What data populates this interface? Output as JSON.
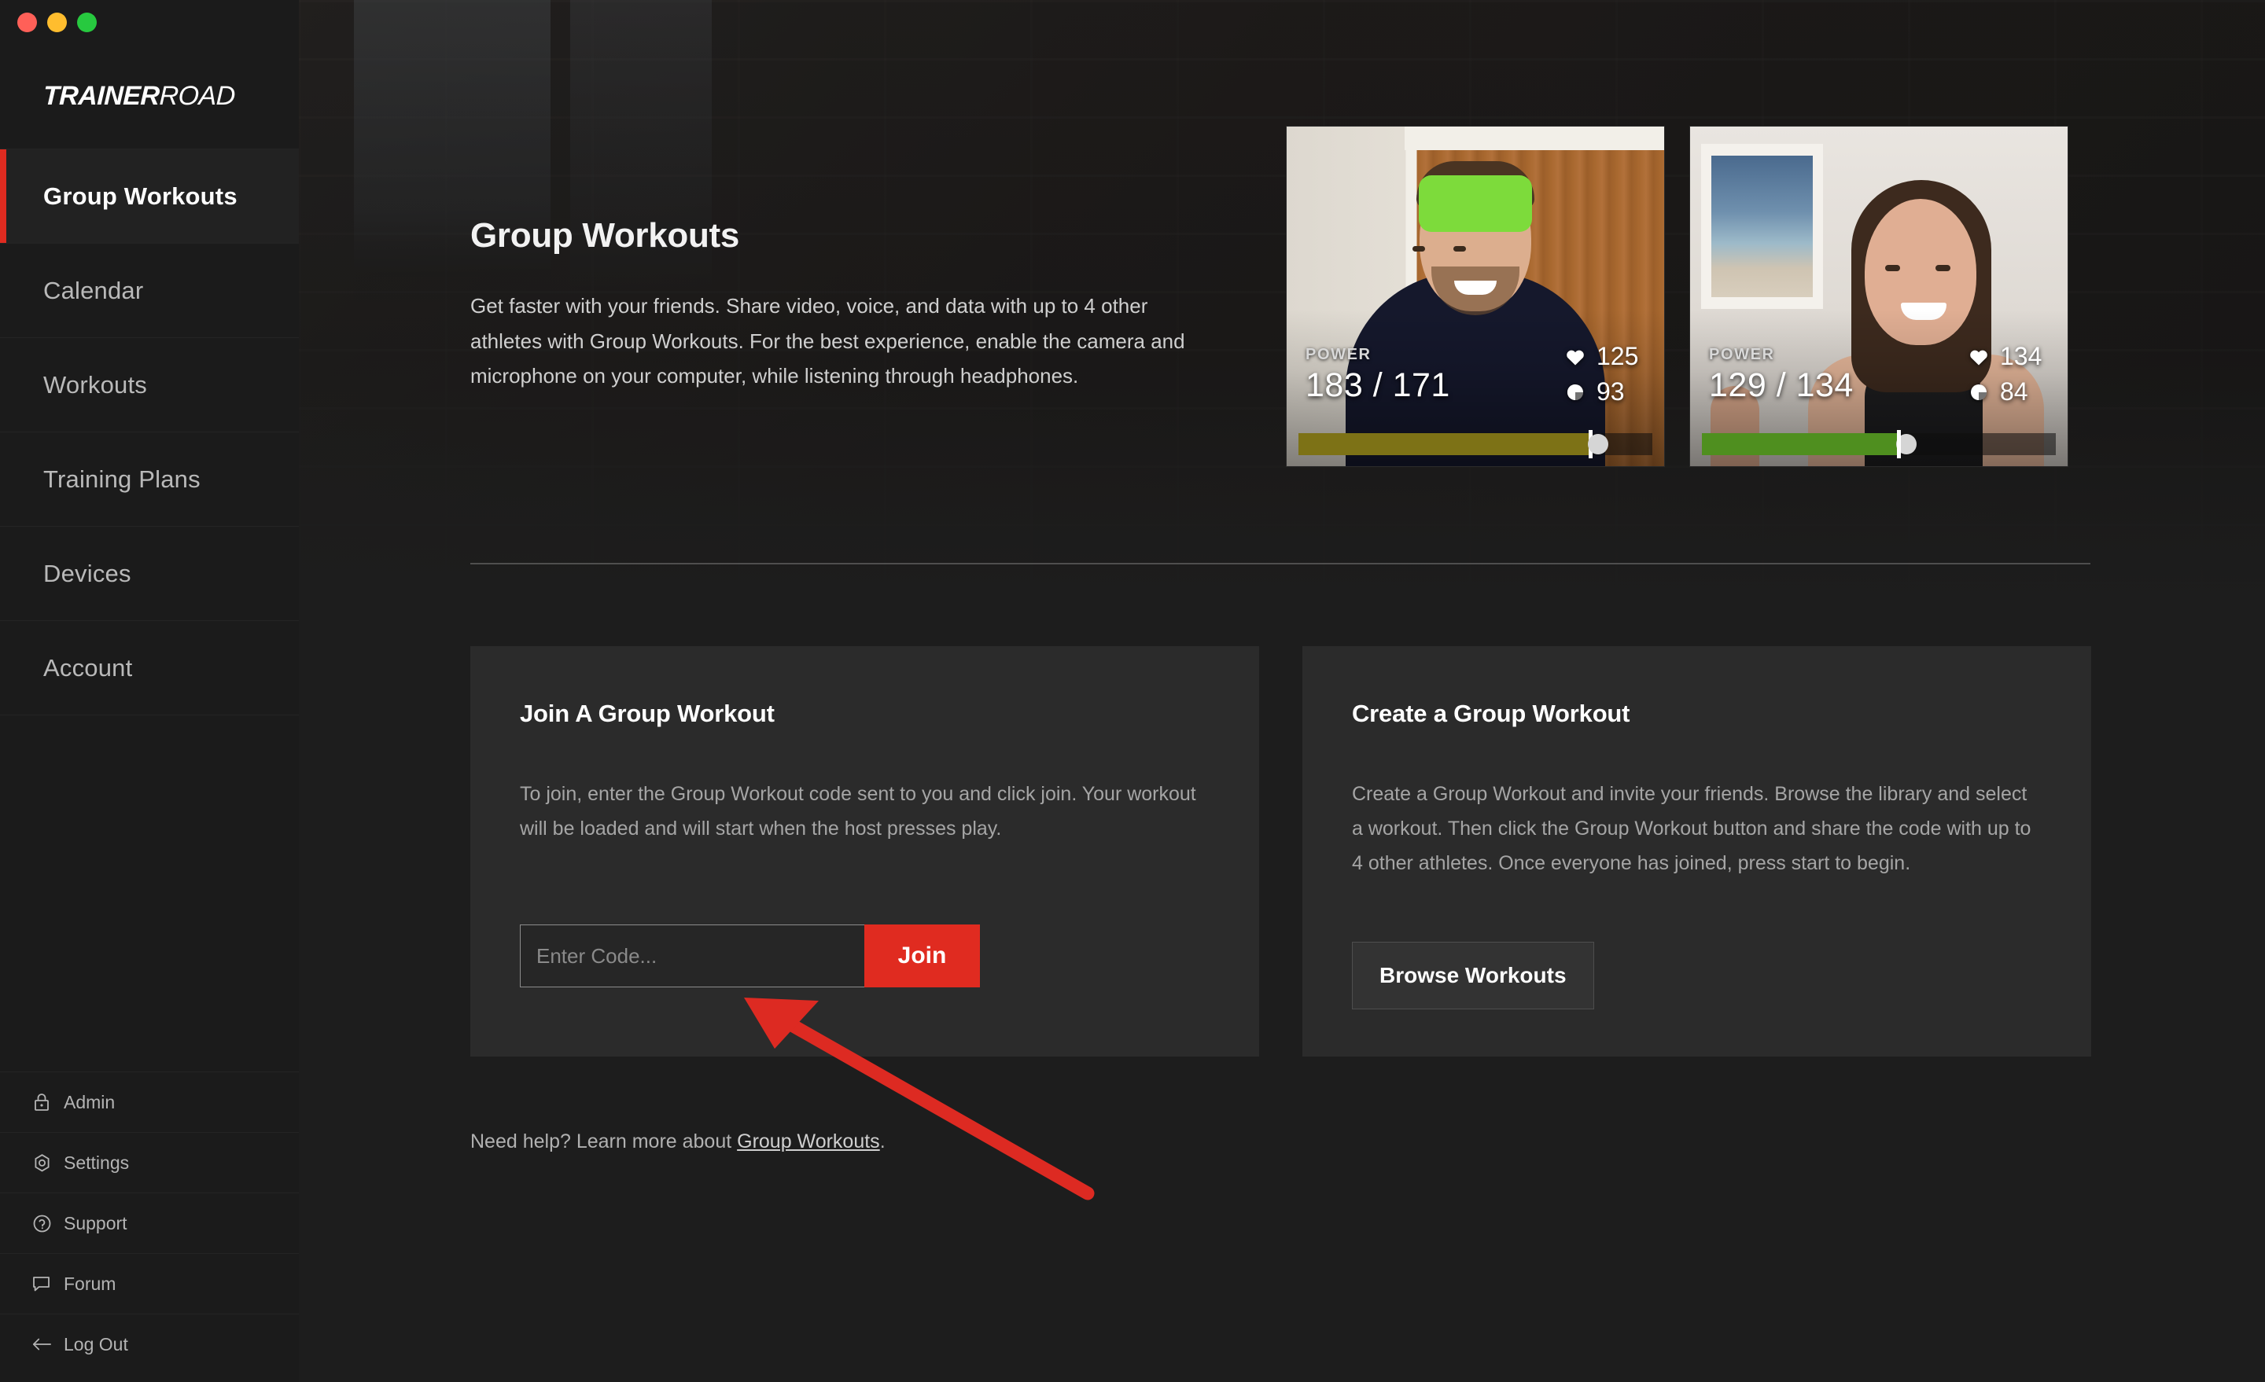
{
  "window": {
    "traffic_lights": [
      "close",
      "minimize",
      "zoom"
    ],
    "accent_red": "#e02b20"
  },
  "sidebar": {
    "logo_bold": "TRAINER",
    "logo_normal": "ROAD",
    "nav": [
      {
        "label": "Group Workouts",
        "active": true
      },
      {
        "label": "Calendar",
        "active": false
      },
      {
        "label": "Workouts",
        "active": false
      },
      {
        "label": "Training Plans",
        "active": false
      },
      {
        "label": "Devices",
        "active": false
      },
      {
        "label": "Account",
        "active": false
      }
    ],
    "footer_nav": [
      {
        "label": "Admin",
        "icon": "lock-icon"
      },
      {
        "label": "Settings",
        "icon": "gear-icon"
      },
      {
        "label": "Support",
        "icon": "question-circle-icon"
      },
      {
        "label": "Forum",
        "icon": "speech-bubble-icon"
      },
      {
        "label": "Log Out",
        "icon": "arrow-left-icon"
      }
    ]
  },
  "hero": {
    "title": "Group Workouts",
    "description": "Get faster with your friends. Share video, voice, and data with up to 4 other athletes with Group Workouts. For the best experience, enable the camera and microphone on your computer, while listening through headphones."
  },
  "video_tiles": [
    {
      "power_label": "POWER",
      "power_value": "183 / 171",
      "heart_rate": "125",
      "cadence": "93",
      "bar_color": "#7d7216",
      "bar_fill_percent": 82
    },
    {
      "power_label": "POWER",
      "power_value": "129 / 134",
      "heart_rate": "134",
      "cadence": "84",
      "bar_color": "#4f8f1f",
      "bar_fill_percent": 55
    }
  ],
  "join_card": {
    "title": "Join A Group Workout",
    "body": "To join, enter the Group Workout code sent to you and click join. Your workout will be loaded and will start when the host presses play.",
    "input_placeholder": "Enter Code...",
    "input_value": "",
    "button_label": "Join"
  },
  "create_card": {
    "title": "Create a Group Workout",
    "body": "Create a Group Workout and invite your friends. Browse the library and select a workout. Then click the Group Workout button and share the code with up to 4 other athletes. Once everyone has joined, press start to begin.",
    "button_label": "Browse Workouts"
  },
  "footnote": {
    "prefix": "Need help? Learn more about ",
    "link": "Group Workouts",
    "suffix": "."
  },
  "annotation": {
    "type": "arrow",
    "color": "#e02b20",
    "points_to": "code-input"
  }
}
